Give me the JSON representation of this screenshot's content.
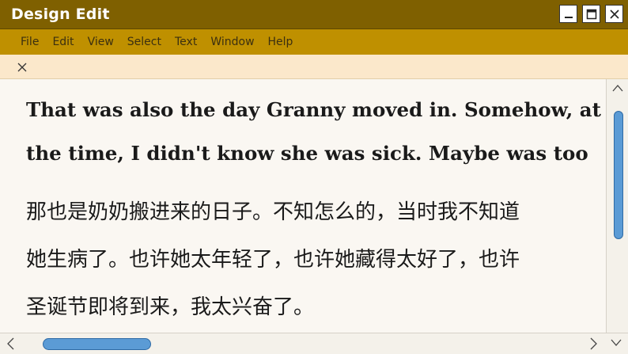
{
  "window": {
    "title": "Design Edit",
    "controls": [
      "minimize-icon",
      "maximize-icon",
      "close-icon"
    ]
  },
  "menu": {
    "items": [
      {
        "label": "File"
      },
      {
        "label": "Edit"
      },
      {
        "label": "View"
      },
      {
        "label": "Select"
      },
      {
        "label": "Text"
      },
      {
        "label": "Window"
      },
      {
        "label": "Help"
      }
    ]
  },
  "document": {
    "english_lines": [
      "That was also the day Granny moved in. Somehow, at",
      "the time, I didn't know she was sick. Maybe was too"
    ],
    "chinese_lines": [
      "那也是奶奶搬进来的日子。不知怎么的，当时我不知道",
      "她生病了。也许她太年轻了，也许她藏得太好了，也许",
      "圣诞节即将到来，我太兴奋了。"
    ]
  },
  "colors": {
    "titlebar": "#7f6000",
    "menubar": "#bf9000",
    "tabbar": "#fbe8cb",
    "scroll_thumb": "#5b9bd5"
  }
}
